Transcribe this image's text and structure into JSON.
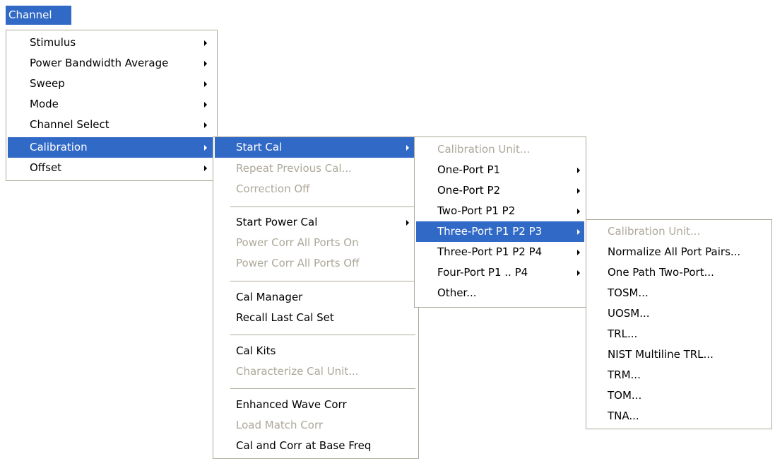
{
  "menubar": {
    "title": "Channel"
  },
  "channel_menu": {
    "items": [
      {
        "label": "Stimulus"
      },
      {
        "label": "Power Bandwidth Average"
      },
      {
        "label": "Sweep"
      },
      {
        "label": "Mode"
      },
      {
        "label": "Channel Select"
      },
      {
        "label": "Calibration"
      },
      {
        "label": "Offset"
      }
    ]
  },
  "calibration_menu": {
    "items": [
      {
        "label": "Start Cal"
      },
      {
        "label": "Repeat Previous Cal..."
      },
      {
        "label": "Correction Off"
      },
      {
        "label": "Start Power Cal"
      },
      {
        "label": "Power Corr All Ports On"
      },
      {
        "label": "Power Corr All Ports Off"
      },
      {
        "label": "Cal Manager"
      },
      {
        "label": "Recall Last Cal Set"
      },
      {
        "label": "Cal Kits"
      },
      {
        "label": "Characterize Cal Unit..."
      },
      {
        "label": "Enhanced Wave Corr"
      },
      {
        "label": "Load Match Corr"
      },
      {
        "label": "Cal and Corr at Base Freq"
      }
    ]
  },
  "start_cal_menu": {
    "items": [
      {
        "label": "Calibration Unit..."
      },
      {
        "label": "One-Port P1"
      },
      {
        "label": "One-Port P2"
      },
      {
        "label": "Two-Port P1 P2"
      },
      {
        "label": "Three-Port P1 P2 P3"
      },
      {
        "label": "Three-Port P1 P2 P4"
      },
      {
        "label": "Four-Port P1 .. P4"
      },
      {
        "label": "Other..."
      }
    ]
  },
  "three_port_menu": {
    "items": [
      {
        "label": "Calibration Unit..."
      },
      {
        "label": "Normalize All Port Pairs..."
      },
      {
        "label": "One Path Two-Port..."
      },
      {
        "label": "TOSM..."
      },
      {
        "label": "UOSM..."
      },
      {
        "label": "TRL..."
      },
      {
        "label": "NIST Multiline TRL..."
      },
      {
        "label": "TRM..."
      },
      {
        "label": "TOM..."
      },
      {
        "label": "TNA..."
      }
    ]
  },
  "colors": {
    "highlight": "#3169c6",
    "disabled_text": "#aca899",
    "border": "#aca899"
  }
}
